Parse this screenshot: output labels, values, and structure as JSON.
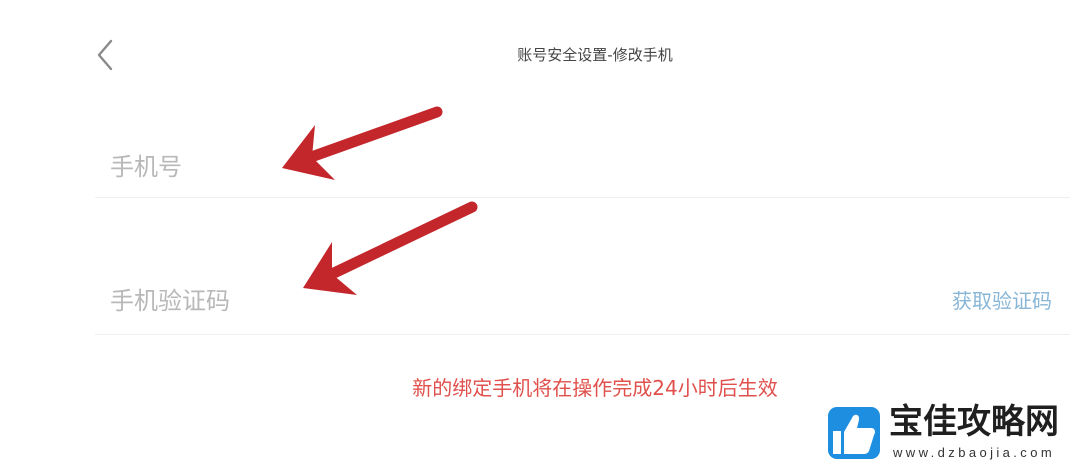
{
  "header": {
    "back_icon": "chevron-left-icon",
    "title": "账号安全设置-修改手机"
  },
  "form": {
    "phone": {
      "placeholder": "手机号"
    },
    "code": {
      "placeholder": "手机验证码"
    },
    "get_code_label": "获取验证码"
  },
  "notice": "新的绑定手机将在操作完成24小时后生效",
  "annotations": {
    "annotation_icon": "red-arrow-icon"
  },
  "watermark": {
    "logo_icon": "thumbs-up-icon",
    "name": "宝佳攻略网",
    "url": "www.dzbaojia.com"
  },
  "colors": {
    "background": "#ffffff",
    "title_text": "#454545",
    "back_icon": "#8a8a8a",
    "placeholder": "#b8b8b8",
    "divider": "#efefef",
    "link": "#88b6d6",
    "notice": "#e0504c",
    "arrow": "#c3262b",
    "brand": "#1d8ee0"
  }
}
